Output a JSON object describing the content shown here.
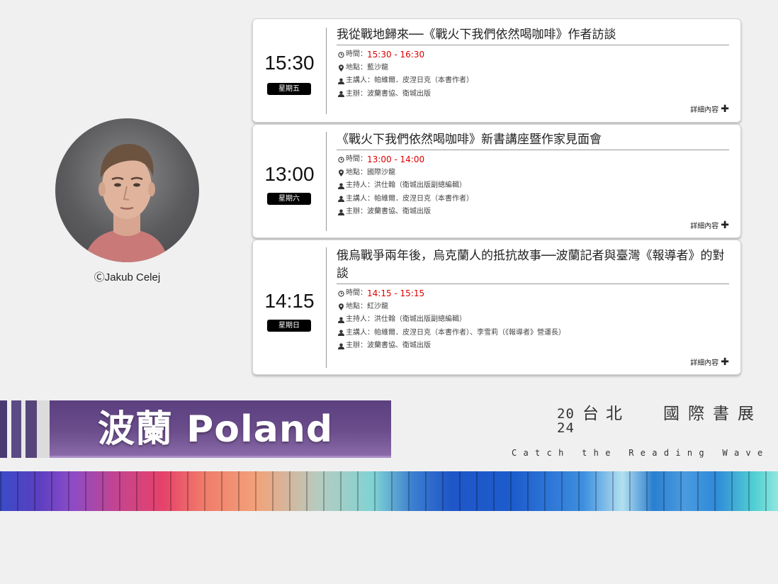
{
  "photo_credit": "ⒸJakub Celej",
  "events": [
    {
      "clock": "15:30",
      "day": "星期五",
      "title": "我從戰地歸來──《戰火下我們依然喝咖啡》作者訪談",
      "time_label": "時間：",
      "time_value": "15:30 - 16:30",
      "rows": [
        {
          "icon": "map-pin-icon",
          "text": "地點：藍沙龍"
        },
        {
          "icon": "user-icon",
          "text": "主講人：帕維爾．皮涅日克（本書作者）"
        },
        {
          "icon": "user-icon",
          "text": "主辦：波蘭書協、衛城出版"
        }
      ],
      "more": "詳細內容"
    },
    {
      "clock": "13:00",
      "day": "星期六",
      "title": "《戰火下我們依然喝咖啡》新書講座暨作家見面會",
      "time_label": "時間：",
      "time_value": "13:00 - 14:00",
      "rows": [
        {
          "icon": "map-pin-icon",
          "text": "地點：國際沙龍"
        },
        {
          "icon": "user-icon",
          "text": "主持人：洪仕翰（衛城出版副總編輯）"
        },
        {
          "icon": "user-icon",
          "text": "主講人：帕維爾．皮涅日克（本書作者）"
        },
        {
          "icon": "user-icon",
          "text": "主辦：波蘭書協、衛城出版"
        }
      ],
      "more": "詳細內容"
    },
    {
      "clock": "14:15",
      "day": "星期日",
      "title": "俄烏戰爭兩年後，烏克蘭人的抵抗故事──波蘭記者與臺灣《報導者》的對談",
      "time_label": "時間：",
      "time_value": "14:15 - 15:15",
      "rows": [
        {
          "icon": "map-pin-icon",
          "text": "地點：紅沙龍"
        },
        {
          "icon": "user-icon",
          "text": "主持人：洪仕翰（衛城出版副總編輯）"
        },
        {
          "icon": "user-icon",
          "text": "主講人：帕維爾．皮涅日克（本書作者）、李雪莉（《報導者》營運長）"
        },
        {
          "icon": "user-icon",
          "text": "主辦：波蘭書協、衛城出版"
        }
      ],
      "more": "詳細內容"
    }
  ],
  "banner": {
    "country": "波蘭 Poland",
    "logo_year": "20\n24",
    "logo_city": "台北",
    "logo_name": "國際書展",
    "logo_tagline": "Catch the Reading Wave"
  },
  "colors": {
    "time_red": "#dd0000",
    "badge_black": "#000000",
    "banner_purple": "#5b3f7f"
  }
}
